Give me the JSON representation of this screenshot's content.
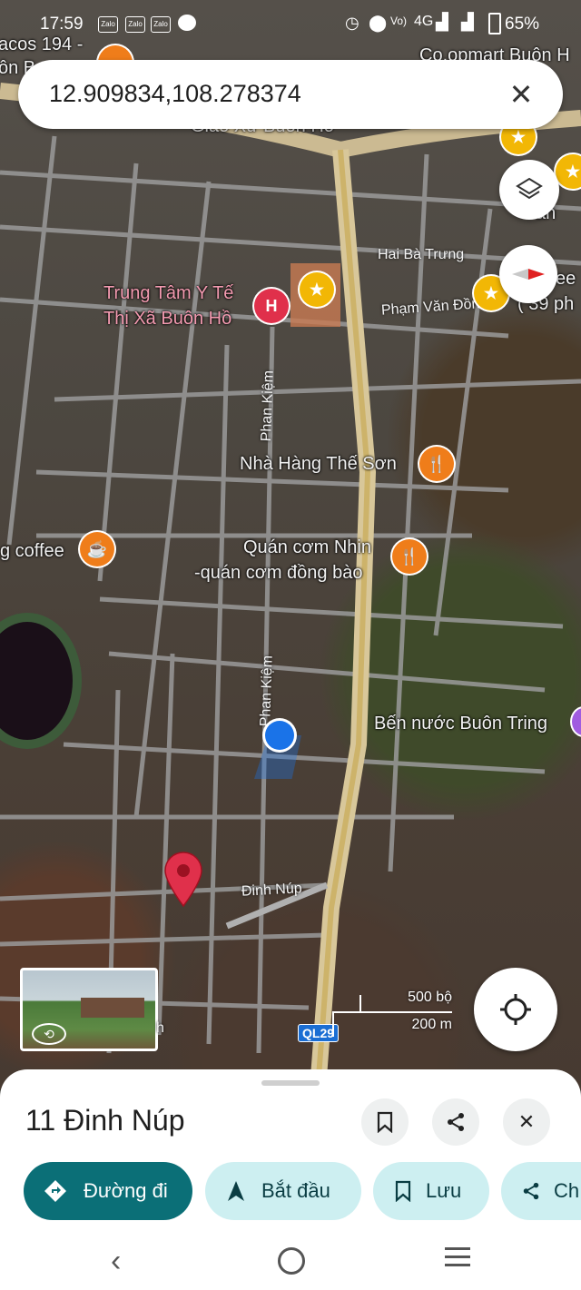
{
  "status_bar": {
    "time": "17:59",
    "notifications": [
      "Zalo",
      "Zalo",
      "Zalo"
    ],
    "network": "4G",
    "battery": "65%"
  },
  "search": {
    "query": "12.909834,108.278374",
    "clear_icon": "close-icon"
  },
  "map": {
    "labels": {
      "top_left": "acos 194 -",
      "top_left2": "ôn B",
      "top_right": "Co.opmart Buôn H",
      "church": "Giáo Xứ Buôn Hồ",
      "hospital_1": "Trung Tâm Y Tế",
      "hospital_2": "Thị Xã Buôn Hồ",
      "restaurant": "Nhà Hàng Thế Sơn",
      "coffee": "g coffee",
      "rice_1": "Quán cơm Nhin",
      "rice_2": "-quán cơm đồng bào",
      "bus": "Bến nước Buôn Tring",
      "right_edge": "( 39 ph",
      "right_edge2": "ân",
      "right_edge3": "ee"
    },
    "roads": {
      "hai_ba_trung": "Hai Bà Trưng",
      "pham_van_dong": "Phạm Văn Đồn",
      "phan_kiem_1": "Phan Kiệm",
      "phan_kiem_2": "Phan Kiệm",
      "dinh_nup": "Đinh Núp",
      "ql": "QL29",
      "h_edge": "h"
    },
    "scale": {
      "top": "500 bộ",
      "bottom": "200 m"
    }
  },
  "place": {
    "title": "11 Đinh Núp",
    "actions": {
      "directions": "Đường đi",
      "start": "Bắt đầu",
      "save": "Lưu",
      "share": "Ch"
    }
  },
  "colors": {
    "primary": "#0b6f77",
    "secondary_chip": "#cdeff1",
    "pin_red": "#e0304b",
    "location_blue": "#1a73e8"
  }
}
